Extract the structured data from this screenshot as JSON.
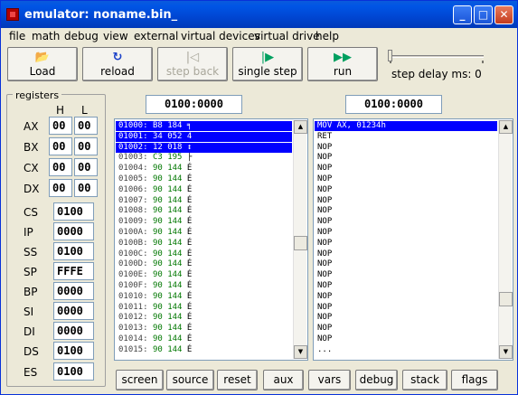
{
  "window": {
    "title": "emulator: noname.bin_"
  },
  "titlebar_buttons": {
    "minimize": "_",
    "maximize": "□",
    "close": "✕"
  },
  "menu": [
    "file",
    "math",
    "debug",
    "view",
    "external",
    "virtual devices",
    "virtual drive",
    "help"
  ],
  "toolbar": {
    "load": {
      "label": "Load",
      "icon": "folder-icon"
    },
    "reload": {
      "label": "reload",
      "icon": "reload-icon"
    },
    "step_back": {
      "label": "step back",
      "icon": "step-back-icon",
      "disabled": true
    },
    "single_step": {
      "label": "single step",
      "icon": "single-step-icon"
    },
    "run": {
      "label": "run",
      "icon": "run-icon"
    },
    "step_delay_label": "step delay ms: 0",
    "step_delay_ms": 0
  },
  "registers": {
    "title": "registers",
    "col_h": "H",
    "col_l": "L",
    "split": [
      {
        "name": "AX",
        "h": "00",
        "l": "00"
      },
      {
        "name": "BX",
        "h": "00",
        "l": "00"
      },
      {
        "name": "CX",
        "h": "00",
        "l": "00"
      },
      {
        "name": "DX",
        "h": "00",
        "l": "00"
      }
    ],
    "full": [
      {
        "name": "CS",
        "value": "0100"
      },
      {
        "name": "IP",
        "value": "0000"
      },
      {
        "name": "SS",
        "value": "0100"
      },
      {
        "name": "SP",
        "value": "FFFE"
      },
      {
        "name": "BP",
        "value": "0000"
      },
      {
        "name": "SI",
        "value": "0000"
      },
      {
        "name": "DI",
        "value": "0000"
      },
      {
        "name": "DS",
        "value": "0100"
      },
      {
        "name": "ES",
        "value": "0100"
      }
    ]
  },
  "memory": {
    "address": "0100:0000",
    "rows": [
      {
        "addr": "01000:",
        "hex": "B8",
        "dec": "184",
        "ch": "╕",
        "selected": true
      },
      {
        "addr": "01001:",
        "hex": "34",
        "dec": "052",
        "ch": "4",
        "selected": true
      },
      {
        "addr": "01002:",
        "hex": "12",
        "dec": "018",
        "ch": "↕",
        "selected": true
      },
      {
        "addr": "01003:",
        "hex": "C3",
        "dec": "195",
        "ch": "├",
        "selected": false
      },
      {
        "addr": "01004:",
        "hex": "90",
        "dec": "144",
        "ch": "É",
        "selected": false
      },
      {
        "addr": "01005:",
        "hex": "90",
        "dec": "144",
        "ch": "É",
        "selected": false
      },
      {
        "addr": "01006:",
        "hex": "90",
        "dec": "144",
        "ch": "É",
        "selected": false
      },
      {
        "addr": "01007:",
        "hex": "90",
        "dec": "144",
        "ch": "É",
        "selected": false
      },
      {
        "addr": "01008:",
        "hex": "90",
        "dec": "144",
        "ch": "É",
        "selected": false
      },
      {
        "addr": "01009:",
        "hex": "90",
        "dec": "144",
        "ch": "É",
        "selected": false
      },
      {
        "addr": "0100A:",
        "hex": "90",
        "dec": "144",
        "ch": "É",
        "selected": false
      },
      {
        "addr": "0100B:",
        "hex": "90",
        "dec": "144",
        "ch": "É",
        "selected": false
      },
      {
        "addr": "0100C:",
        "hex": "90",
        "dec": "144",
        "ch": "É",
        "selected": false
      },
      {
        "addr": "0100D:",
        "hex": "90",
        "dec": "144",
        "ch": "É",
        "selected": false
      },
      {
        "addr": "0100E:",
        "hex": "90",
        "dec": "144",
        "ch": "É",
        "selected": false
      },
      {
        "addr": "0100F:",
        "hex": "90",
        "dec": "144",
        "ch": "É",
        "selected": false
      },
      {
        "addr": "01010:",
        "hex": "90",
        "dec": "144",
        "ch": "É",
        "selected": false
      },
      {
        "addr": "01011:",
        "hex": "90",
        "dec": "144",
        "ch": "É",
        "selected": false
      },
      {
        "addr": "01012:",
        "hex": "90",
        "dec": "144",
        "ch": "É",
        "selected": false
      },
      {
        "addr": "01013:",
        "hex": "90",
        "dec": "144",
        "ch": "É",
        "selected": false
      },
      {
        "addr": "01014:",
        "hex": "90",
        "dec": "144",
        "ch": "É",
        "selected": false
      },
      {
        "addr": "01015:",
        "hex": "90",
        "dec": "144",
        "ch": "É",
        "selected": false
      }
    ]
  },
  "disassembly": {
    "address": "0100:0000",
    "rows": [
      {
        "text": "MOV AX, 01234h",
        "selected": true
      },
      {
        "text": "RET",
        "selected": false
      },
      {
        "text": "NOP",
        "selected": false
      },
      {
        "text": "NOP",
        "selected": false
      },
      {
        "text": "NOP",
        "selected": false
      },
      {
        "text": "NOP",
        "selected": false
      },
      {
        "text": "NOP",
        "selected": false
      },
      {
        "text": "NOP",
        "selected": false
      },
      {
        "text": "NOP",
        "selected": false
      },
      {
        "text": "NOP",
        "selected": false
      },
      {
        "text": "NOP",
        "selected": false
      },
      {
        "text": "NOP",
        "selected": false
      },
      {
        "text": "NOP",
        "selected": false
      },
      {
        "text": "NOP",
        "selected": false
      },
      {
        "text": "NOP",
        "selected": false
      },
      {
        "text": "NOP",
        "selected": false
      },
      {
        "text": "NOP",
        "selected": false
      },
      {
        "text": "NOP",
        "selected": false
      },
      {
        "text": "NOP",
        "selected": false
      },
      {
        "text": "NOP",
        "selected": false
      },
      {
        "text": "NOP",
        "selected": false
      },
      {
        "text": "...",
        "selected": false
      }
    ]
  },
  "bottom_buttons": [
    "screen",
    "source",
    "reset",
    "aux",
    "vars",
    "debug",
    "stack",
    "flags"
  ],
  "colors": {
    "selection": "#0000ff",
    "hex_value": "#007700",
    "titlebar": "#0046d2"
  }
}
